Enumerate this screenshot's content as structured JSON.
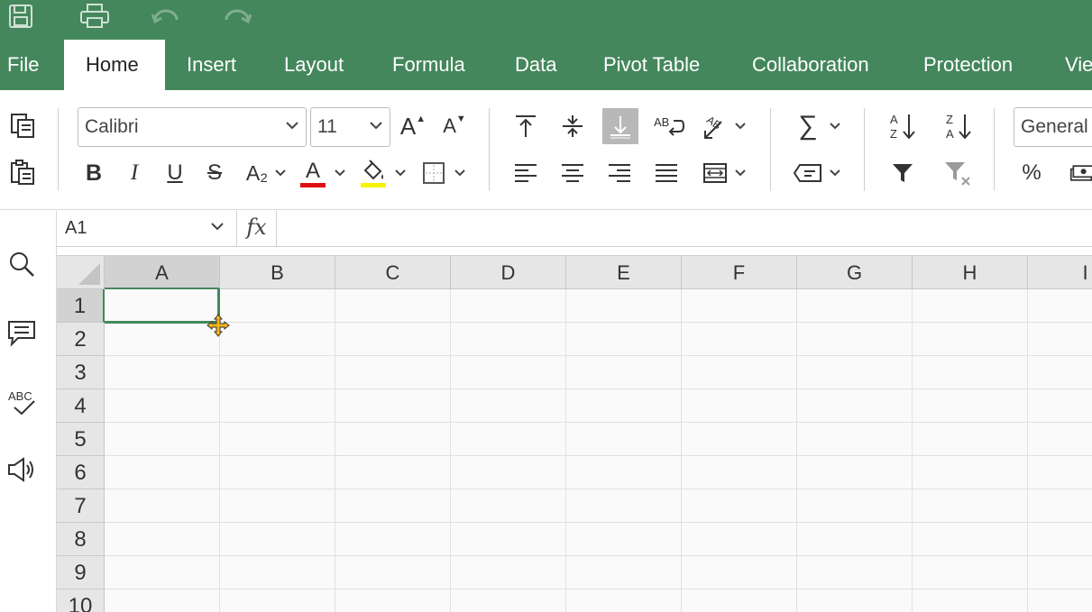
{
  "colors": {
    "accent": "#44875c",
    "font_color_bar": "#e01010",
    "fill_color_bar": "#f4f400"
  },
  "quick_access": [
    {
      "name": "save-icon"
    },
    {
      "name": "print-icon"
    },
    {
      "name": "undo-icon"
    },
    {
      "name": "redo-icon"
    }
  ],
  "menu": {
    "tabs": [
      {
        "label": "File"
      },
      {
        "label": "Home"
      },
      {
        "label": "Insert"
      },
      {
        "label": "Layout"
      },
      {
        "label": "Formula"
      },
      {
        "label": "Data"
      },
      {
        "label": "Pivot Table"
      },
      {
        "label": "Collaboration"
      },
      {
        "label": "Protection"
      },
      {
        "label": "Vie"
      }
    ],
    "active": "Home"
  },
  "ribbon": {
    "font_name": "Calibri",
    "font_size": "11",
    "number_format": "General",
    "percent_label": "%",
    "autosum_symbol": "∑",
    "bold": "B",
    "italic": "I",
    "underline": "U",
    "strike": "S",
    "font_color_letter": "A",
    "grow_font": "A",
    "shrink_font": "A",
    "subscript": "A₂"
  },
  "formula_bar": {
    "cell_ref": "A1",
    "fx": "fx",
    "formula": ""
  },
  "grid": {
    "columns": [
      "A",
      "B",
      "C",
      "D",
      "E",
      "F",
      "G",
      "H",
      "I"
    ],
    "rows": [
      "1",
      "2",
      "3",
      "4",
      "5",
      "6",
      "7",
      "8",
      "9",
      "10"
    ],
    "selected_cell": "A1"
  },
  "sidebar": [
    {
      "name": "search-icon"
    },
    {
      "name": "comment-icon"
    },
    {
      "name": "spellcheck-icon"
    },
    {
      "name": "speaker-icon"
    }
  ]
}
